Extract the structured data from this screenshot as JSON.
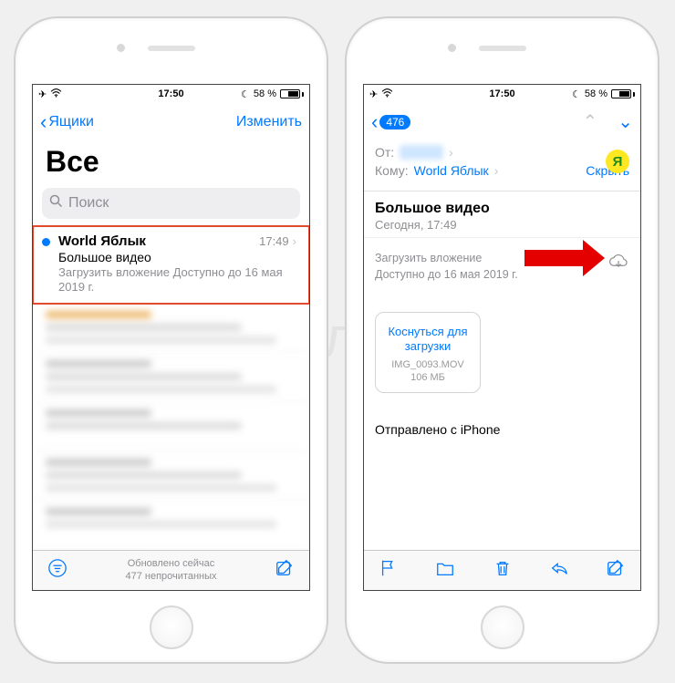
{
  "status": {
    "time": "17:50",
    "battery_pct": "58 %"
  },
  "left": {
    "nav": {
      "back_label": "Ящики",
      "edit_label": "Изменить"
    },
    "title": "Все",
    "search_placeholder": "Поиск",
    "message": {
      "sender": "World Яблык",
      "time": "17:49",
      "subject": "Большое видео",
      "preview": "Загрузить вложение Доступно до 16 мая 2019 г."
    },
    "toolbar": {
      "updated": "Обновлено сейчас",
      "unread": "477 непрочитанных"
    }
  },
  "right": {
    "nav": {
      "back_badge": "476"
    },
    "header": {
      "from_label": "От:",
      "to_label": "Кому:",
      "to_value": "World Яблык",
      "hide_label": "Скрыть",
      "avatar_letter": "Я"
    },
    "msg": {
      "title": "Большое видео",
      "date": "Сегодня, 17:49",
      "att_line1": "Загрузить вложение",
      "att_line2": "Доступно до 16 мая 2019 г."
    },
    "attachment": {
      "tap_label": "Коснуться для загрузки",
      "filename": "IMG_0093.MOV",
      "size": "106 МБ"
    },
    "sent_from": "Отправлено с iPhone"
  },
  "watermark": "Яблык"
}
